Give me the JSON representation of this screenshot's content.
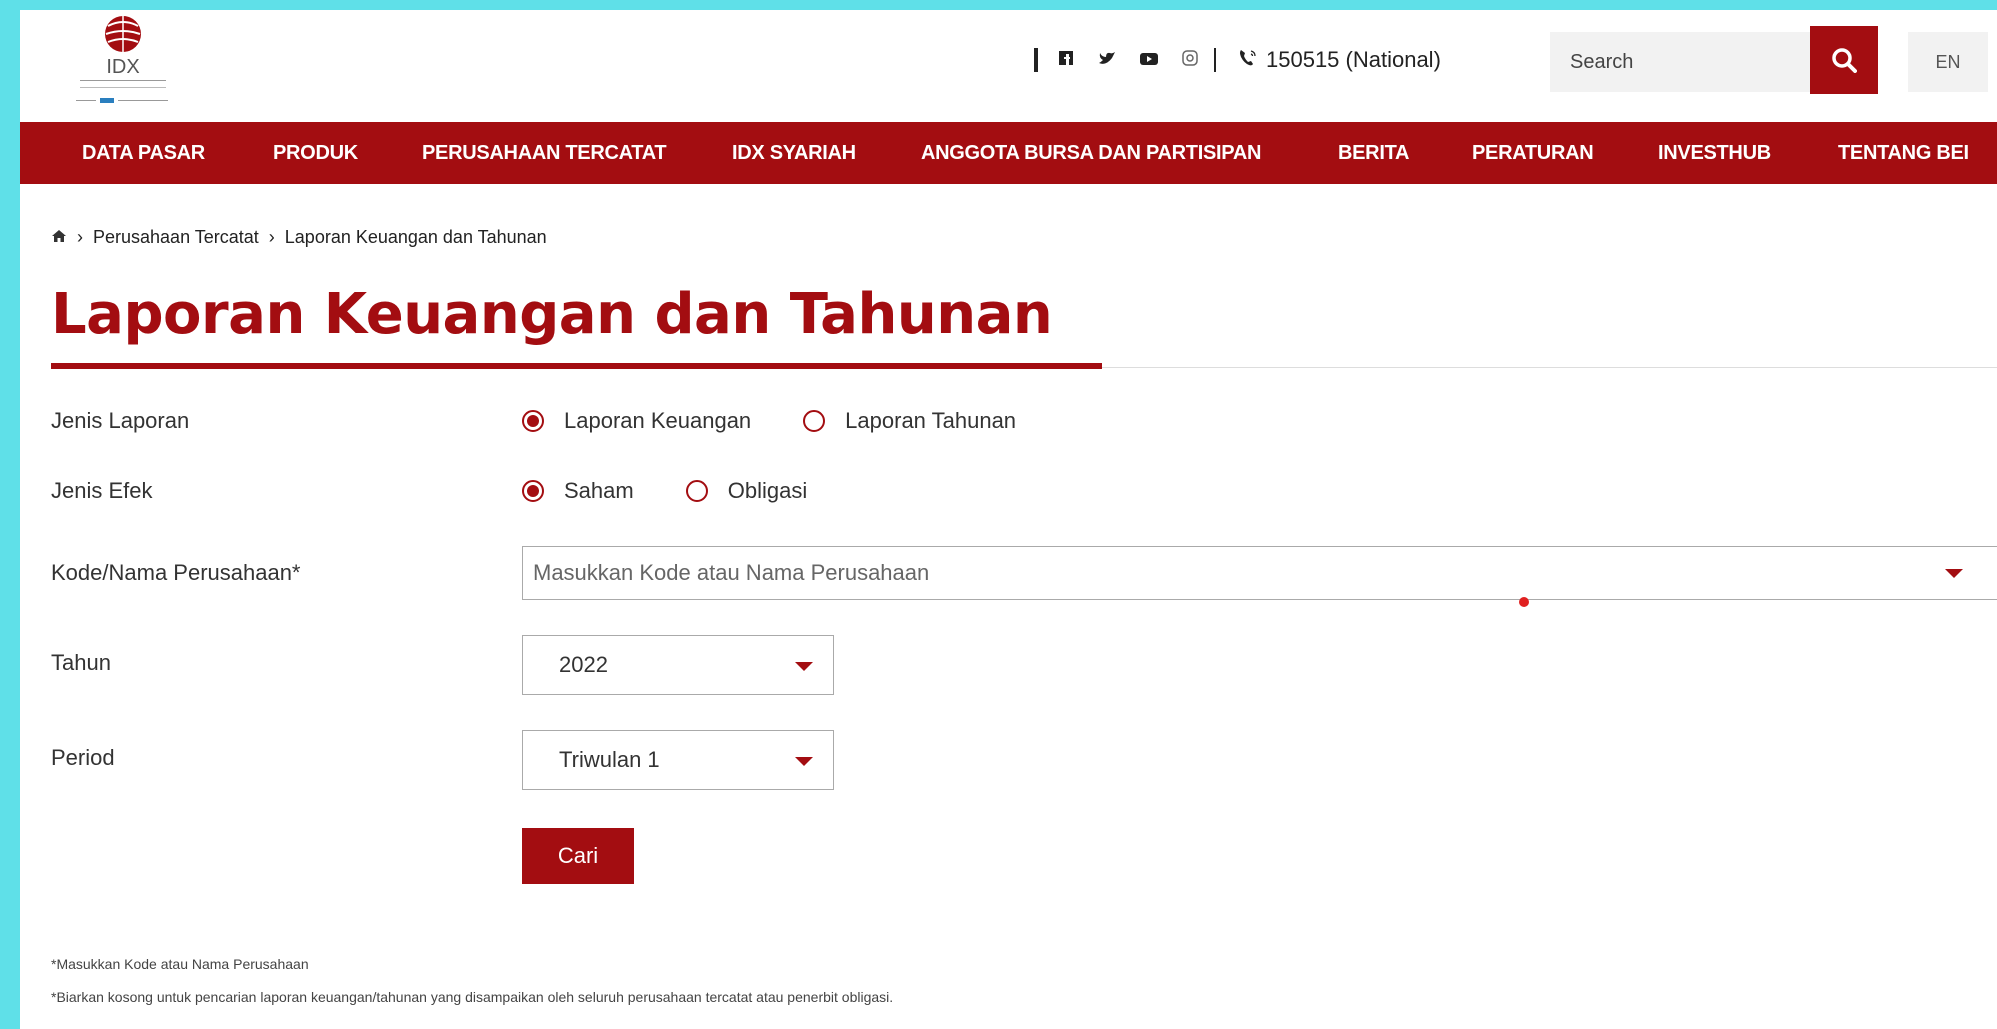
{
  "header": {
    "logo_text": "IDX",
    "phone_label": "150515 (National)",
    "search_placeholder": "Search",
    "lang_label": "EN",
    "social_icons": [
      "facebook-icon",
      "twitter-icon",
      "youtube-icon",
      "instagram-icon"
    ]
  },
  "nav": {
    "items": [
      {
        "label": "DATA PASAR"
      },
      {
        "label": "PRODUK"
      },
      {
        "label": "PERUSAHAAN TERCATAT"
      },
      {
        "label": "IDX SYARIAH"
      },
      {
        "label": "ANGGOTA BURSA DAN PARTISIPAN"
      },
      {
        "label": "BERITA"
      },
      {
        "label": "PERATURAN"
      },
      {
        "label": "INVESTHUB"
      },
      {
        "label": "TENTANG BEI"
      }
    ]
  },
  "breadcrumb": {
    "items": [
      "Perusahaan Tercatat",
      "Laporan Keuangan dan Tahunan"
    ]
  },
  "page": {
    "title": "Laporan Keuangan dan Tahunan"
  },
  "form": {
    "jenis_laporan": {
      "label": "Jenis Laporan",
      "options": [
        {
          "label": "Laporan Keuangan",
          "selected": true
        },
        {
          "label": "Laporan Tahunan",
          "selected": false
        }
      ]
    },
    "jenis_efek": {
      "label": "Jenis Efek",
      "options": [
        {
          "label": "Saham",
          "selected": true
        },
        {
          "label": "Obligasi",
          "selected": false
        }
      ]
    },
    "company": {
      "label": "Kode/Nama Perusahaan*",
      "placeholder": "Masukkan Kode atau Nama Perusahaan"
    },
    "tahun": {
      "label": "Tahun",
      "value": "2022"
    },
    "period": {
      "label": "Period",
      "value": "Triwulan 1"
    },
    "submit_label": "Cari"
  },
  "notes": [
    "*Masukkan Kode atau Nama Perusahaan",
    "*Biarkan kosong untuk pencarian laporan keuangan/tahunan yang disampaikan oleh seluruh perusahaan tercatat atau penerbit obligasi."
  ],
  "colors": {
    "brand": "#a30d11",
    "frame_background": "#5fe0e8"
  }
}
